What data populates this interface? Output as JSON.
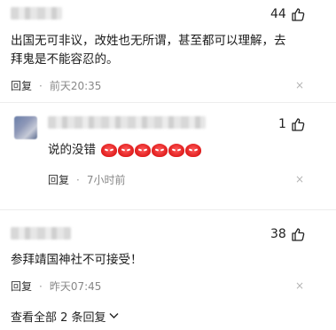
{
  "comments": [
    {
      "likes": "44",
      "text_line1": "出国无可非议，改姓也无所谓，甚至都可以理解，去",
      "text_line2": "拜鬼是不能容忍的。",
      "reply_label": "回复",
      "time": "前天20:35",
      "close": "×"
    },
    {
      "likes": "1",
      "text": "说的没错",
      "emoji_icon": "angry-face-icon",
      "emoji_count": 6,
      "reply_label": "回复",
      "time": "7小时前",
      "close": "×"
    },
    {
      "likes": "38",
      "text": "参拜靖国神社不可接受！",
      "reply_label": "回复",
      "time": "昨天07:45",
      "close": "×"
    }
  ],
  "separator": "·",
  "expand_replies": "查看全部 2 条回复",
  "colors": {
    "accent": "#e01d1d",
    "meta": "#888888"
  }
}
